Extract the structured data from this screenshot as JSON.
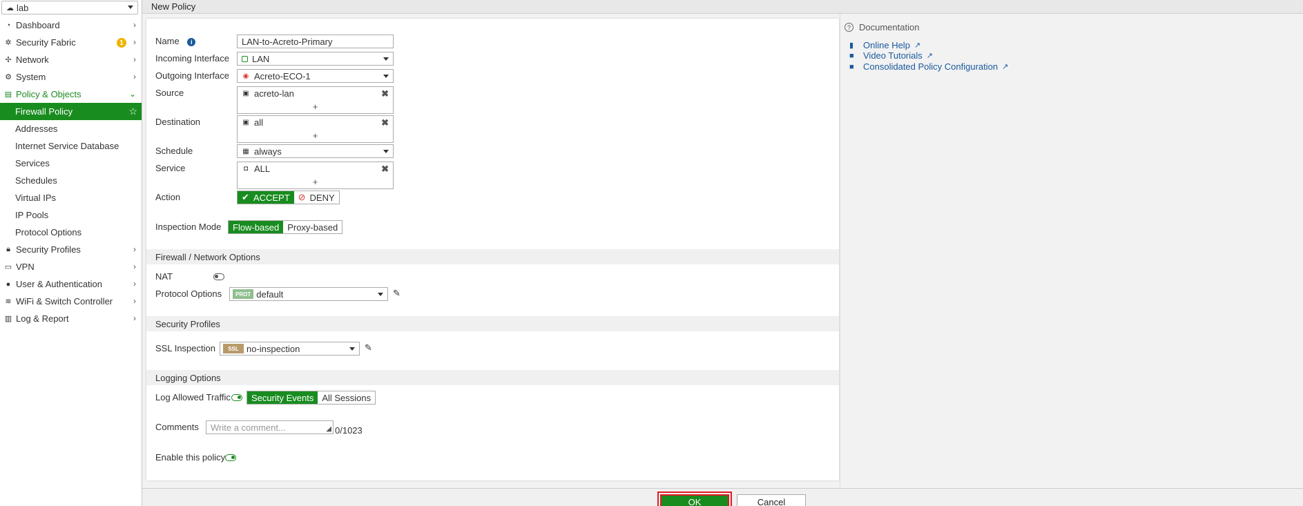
{
  "vdom": {
    "label": "lab"
  },
  "page_title": "New Policy",
  "sidebar": {
    "items": [
      {
        "label": "Dashboard",
        "icon": "dashboard-icon"
      },
      {
        "label": "Security Fabric",
        "icon": "security-fabric-icon",
        "badge": "1"
      },
      {
        "label": "Network",
        "icon": "network-icon"
      },
      {
        "label": "System",
        "icon": "gear-icon"
      },
      {
        "label": "Policy & Objects",
        "icon": "policy-icon"
      },
      {
        "label": "Firewall Policy"
      },
      {
        "label": "Addresses"
      },
      {
        "label": "Internet Service Database"
      },
      {
        "label": "Services"
      },
      {
        "label": "Schedules"
      },
      {
        "label": "Virtual IPs"
      },
      {
        "label": "IP Pools"
      },
      {
        "label": "Protocol Options"
      },
      {
        "label": "Security Profiles",
        "icon": "lock-icon"
      },
      {
        "label": "VPN",
        "icon": "laptop-icon"
      },
      {
        "label": "User & Authentication",
        "icon": "user-icon"
      },
      {
        "label": "WiFi & Switch Controller",
        "icon": "wifi-icon"
      },
      {
        "label": "Log & Report",
        "icon": "chart-icon"
      }
    ]
  },
  "form": {
    "name_label": "Name",
    "name_value": "LAN-to-Acreto-Primary",
    "incoming_label": "Incoming Interface",
    "incoming_value": "LAN",
    "outgoing_label": "Outgoing Interface",
    "outgoing_value": "Acreto-ECO-1",
    "source_label": "Source",
    "source_value": "acreto-lan",
    "destination_label": "Destination",
    "destination_value": "all",
    "schedule_label": "Schedule",
    "schedule_value": "always",
    "service_label": "Service",
    "service_value": "ALL",
    "action_label": "Action",
    "accept_label": "ACCEPT",
    "deny_label": "DENY",
    "inspection_label": "Inspection Mode",
    "flow_label": "Flow-based",
    "proxy_label": "Proxy-based",
    "fw_section": "Firewall / Network Options",
    "nat_label": "NAT",
    "protocol_label": "Protocol Options",
    "protocol_tag": "PROT",
    "protocol_value": "default",
    "sec_section": "Security Profiles",
    "ssl_label": "SSL Inspection",
    "ssl_tag": "SSL",
    "ssl_value": "no-inspection",
    "log_section": "Logging Options",
    "log_label": "Log Allowed Traffic",
    "sec_events_label": "Security Events",
    "all_sessions_label": "All Sessions",
    "comments_label": "Comments",
    "comments_placeholder": "Write a comment...",
    "comments_count": "0/1023",
    "enable_label": "Enable this policy"
  },
  "docs": {
    "heading": "Documentation",
    "links": [
      {
        "label": "Online Help",
        "icon": "book-icon"
      },
      {
        "label": "Video Tutorials",
        "icon": "video-icon"
      },
      {
        "label": "Consolidated Policy Configuration",
        "icon": "video-icon"
      }
    ]
  },
  "buttons": {
    "ok": "OK",
    "cancel": "Cancel"
  },
  "colors": {
    "accent": "#198c1f",
    "highlight": "#e01b24",
    "link": "#1a5a9e",
    "badge": "#f0b400"
  }
}
